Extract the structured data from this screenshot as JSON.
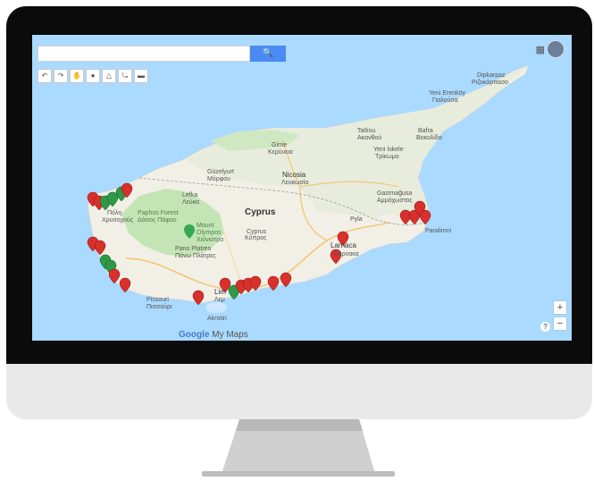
{
  "map": {
    "search_placeholder": "",
    "search_button_icon": "search-icon",
    "toolbar_icons": [
      "undo-icon",
      "redo-icon",
      "hand-icon",
      "marker-icon",
      "polygon-icon",
      "route-icon",
      "ruler-icon"
    ],
    "attribution_brand": "Google",
    "attribution_product": "My Maps",
    "zoom_in": "+",
    "zoom_out": "−",
    "help": "?",
    "apps_icon": "apps-grid-icon",
    "labels": {
      "country": "Cyprus",
      "country_gr": "Κύπρος",
      "nicosia": "Nicosia",
      "nicosia_gr": "Λευκωσία",
      "cyprus_center": "Cyprus",
      "cyprus_center_gr": "Κύπρος",
      "paphos_forest": "Paphos Forest",
      "paphos_forest_gr": "Δάσος Πάφου",
      "mount_olympos": "Mount",
      "mount_olympos_2": "Olympos",
      "mount_olympos_gr": "Χιόνιστρα",
      "pano_platres": "Pano Platres",
      "pano_platres_gr": "Πάνω Πλάτρες",
      "lefka": "Lefka",
      "lefka_gr": "Λεύκα",
      "guzelyurt": "Güzelyurt",
      "guzelyurt_gr": "Μόρφου",
      "girne": "Girne",
      "girne_gr": "Κερύνεια",
      "tatlisu": "Tatlısu",
      "tatlisu_gr": "Ακανθού",
      "bafra": "Bafra",
      "bafra_gr": "Βοκολίδα",
      "yeni_iskele": "Yeni İskele",
      "yeni_iskele_gr": "Τρίκωμο",
      "gazimagusa": "Gazimağusa",
      "gazimagusa_gr": "Αμμόχωστος",
      "yeni_erenkoy": "Yeni Erenköy",
      "yeni_erenkoy_gr": "Γιαλούσα",
      "dipkarpaz": "Dipkarpaz",
      "dipkarpaz_gr": "Ριζοκάρπασο",
      "polis": "Πόλη",
      "polis_2": "Χρυσοχούς",
      "larnaca": "Larnaca",
      "larnaca_gr": "Λάρνακα",
      "limassol": "Lim",
      "limassol_gr": "Λεμ",
      "pissouri": "Pissouri",
      "pissouri_gr": "Πισσούρι",
      "akrotiri": "Akrotiri",
      "paralimni": "Paralimni",
      "pyla": "Pyla"
    }
  },
  "colors": {
    "sea": "#aadaff",
    "land": "#f1efe6",
    "north_land": "#eaeee0",
    "forest": "#c3e5b5",
    "marker_red": "#d9302c",
    "marker_green": "#2e9a47",
    "search_button": "#4a8af4"
  }
}
